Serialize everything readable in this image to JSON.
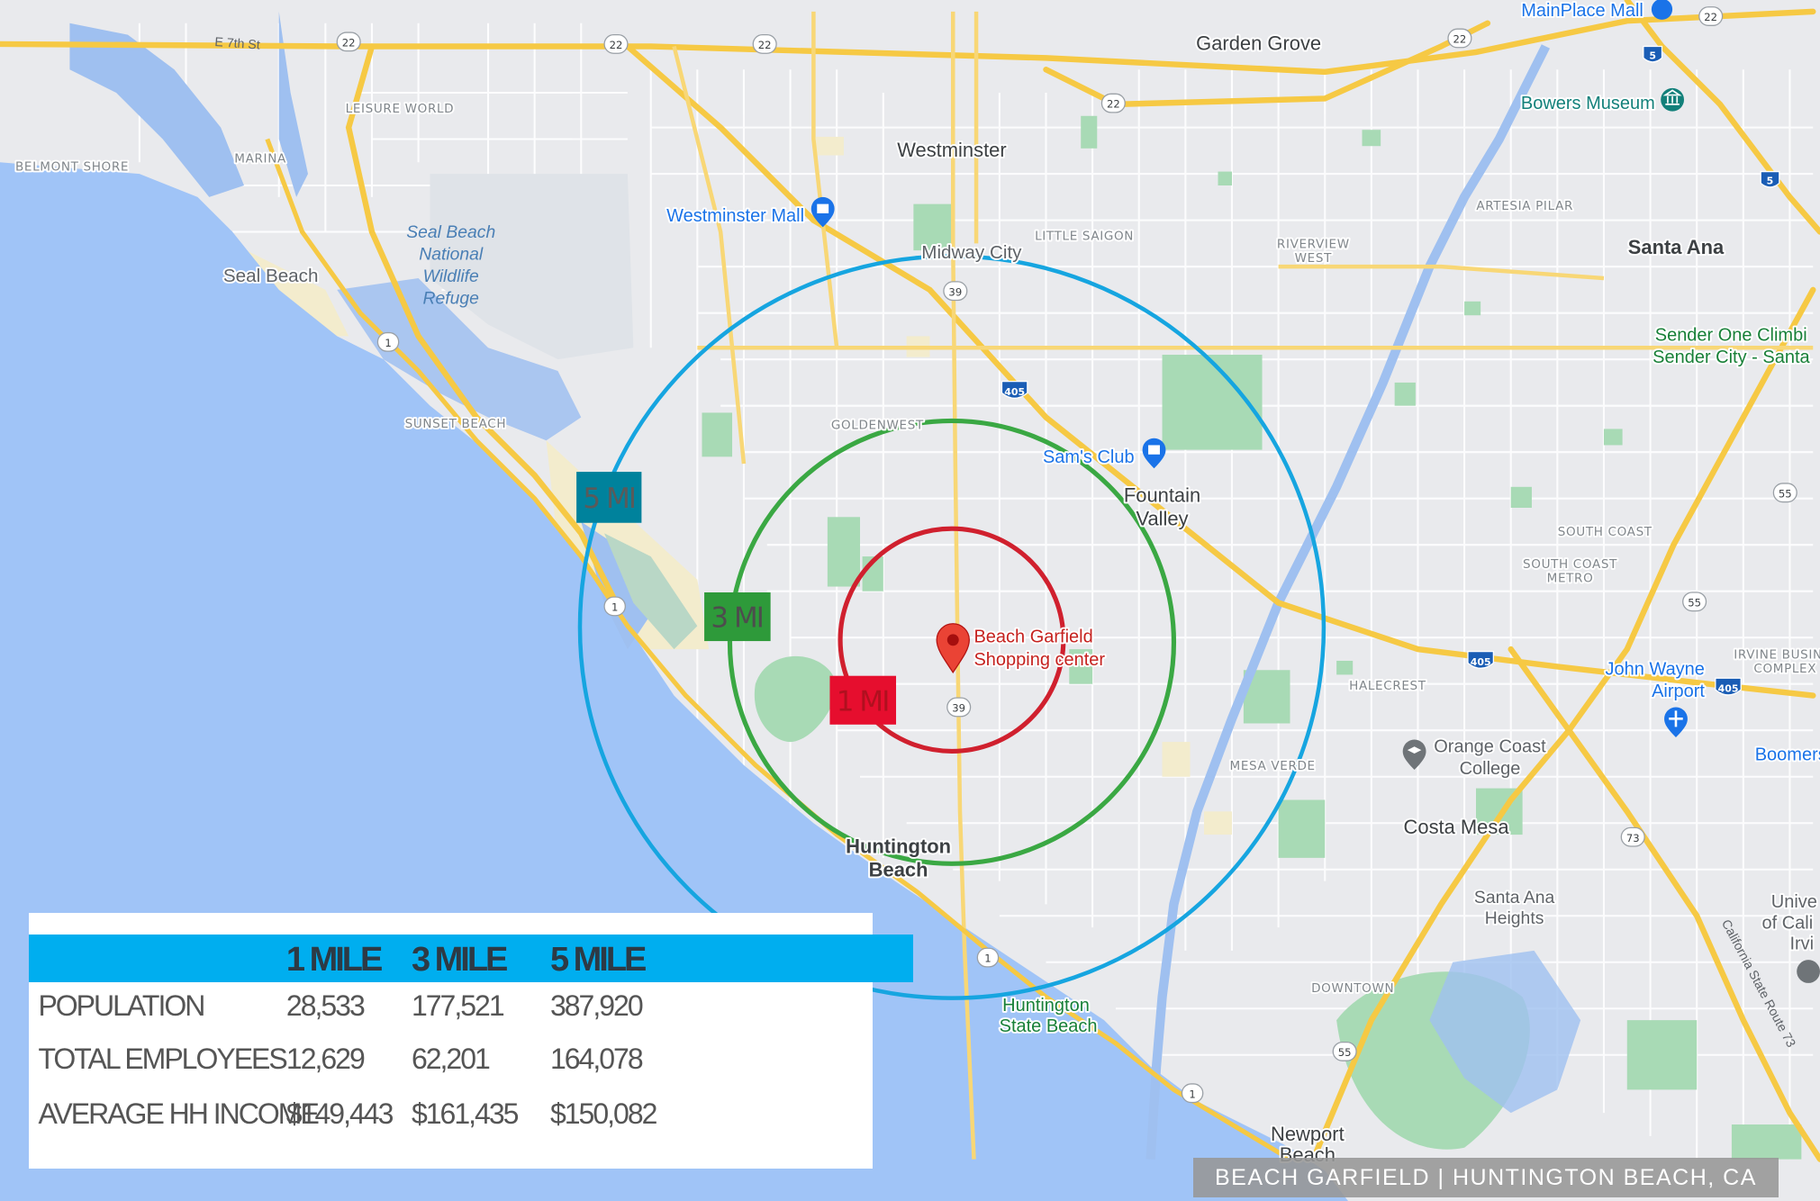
{
  "map": {
    "cities": {
      "garden_grove": "Garden Grove",
      "westminster": "Westminster",
      "santa_ana": "Santa Ana",
      "seal_beach": "Seal Beach",
      "midway_city": "Midway City",
      "fountain_valley": [
        "Fountain",
        "Valley"
      ],
      "huntington_beach": [
        "Huntington",
        "Beach"
      ],
      "costa_mesa": "Costa Mesa",
      "santa_ana_heights": [
        "Santa Ana",
        "Heights"
      ],
      "newport_beach": [
        "Newport",
        "Beach"
      ]
    },
    "neighborhoods": {
      "leisure_world": "LEISURE WORLD",
      "marina": "MARINA",
      "belmont_shore": "BELMONT SHORE",
      "sunset_beach": "SUNSET BEACH",
      "goldenwest": "GOLDENWEST",
      "little_saigon": "LITTLE SAIGON",
      "riverview_west": [
        "RIVERVIEW",
        "WEST"
      ],
      "artesia_pilar": "ARTESIA PILAR",
      "south_coast": "SOUTH COAST",
      "south_coast_metro": [
        "SOUTH COAST",
        "METRO"
      ],
      "irvine_business_complex": [
        "IRVINE BUSIN",
        "COMPLEX"
      ],
      "halecrest": "HALECREST",
      "mesa_verde": "MESA VERDE",
      "downtown": "DOWNTOWN"
    },
    "streets": {
      "e_7th_st": "E 7th St",
      "california_state_route_73": "California State Route 73"
    },
    "shields": {
      "sr22_a": "22",
      "sr22_b": "22",
      "sr22_c": "22",
      "sr22_d": "22",
      "sr22_e": "22",
      "sr22_f": "22",
      "sr1_a": "1",
      "sr1_b": "1",
      "sr1_c": "1",
      "sr1_d": "1",
      "sr39_a": "39",
      "sr39_b": "39",
      "i405_a": "405",
      "i405_b": "405",
      "i405_c": "405",
      "i5_a": "5",
      "i5_b": "5",
      "sr55_a": "55",
      "sr55_b": "55",
      "sr55_c": "55",
      "sr73": "73"
    },
    "places": {
      "mainplace_mall": "MainPlace Mall",
      "bowers_museum": "Bowers Museum",
      "westminster_mall": "Westminster Mall",
      "sams_club": "Sam's Club",
      "seal_beach_refuge": [
        "Seal Beach",
        "National",
        "Wildlife",
        "Refuge"
      ],
      "sender_one": [
        "Sender One Climbi",
        "Sender City - Santa"
      ],
      "john_wayne_airport": [
        "John Wayne",
        "Airport"
      ],
      "orange_coast_college": [
        "Orange Coast",
        "College"
      ],
      "boomers": "Boomers Ir",
      "university": [
        "Unive",
        "of Cali",
        "Irvi"
      ],
      "huntington_state_beach": [
        "Huntington",
        "State Beach"
      ],
      "subject": [
        "Beach Garfield",
        "Shopping center"
      ]
    },
    "rings": {
      "one": "1 MI",
      "three": "3 MI",
      "five": "5 MI"
    },
    "colors": {
      "ring_1mi": "#d0202e",
      "ring_3mi": "#3aa843",
      "ring_5mi": "#16a5e0",
      "water": "#a0c4f7",
      "land": "#e9eaed",
      "highway": "#f6c944",
      "park": "#a8dab5",
      "table_header": "#00aeef"
    },
    "icons": {
      "subject_pin": "red-map-pin-icon",
      "shopping": "shopping-bag-icon",
      "museum": "museum-icon",
      "college": "graduation-cap-icon",
      "airport": "airplane-icon"
    }
  },
  "demographics": {
    "columns": [
      "",
      "1 MILE",
      "3 MILE",
      "5 MILE"
    ],
    "rows": [
      {
        "label": "POPULATION",
        "values": [
          "28,533",
          "177,521",
          "387,920"
        ]
      },
      {
        "label": "TOTAL EMPLOYEES",
        "values": [
          "12,629",
          "62,201",
          "164,078"
        ]
      },
      {
        "label": "AVERAGE HH INCOME",
        "values": [
          "$149,443",
          "$161,435",
          "$150,082"
        ]
      }
    ]
  },
  "caption": "BEACH GARFIELD | HUNTINGTON BEACH, CA"
}
